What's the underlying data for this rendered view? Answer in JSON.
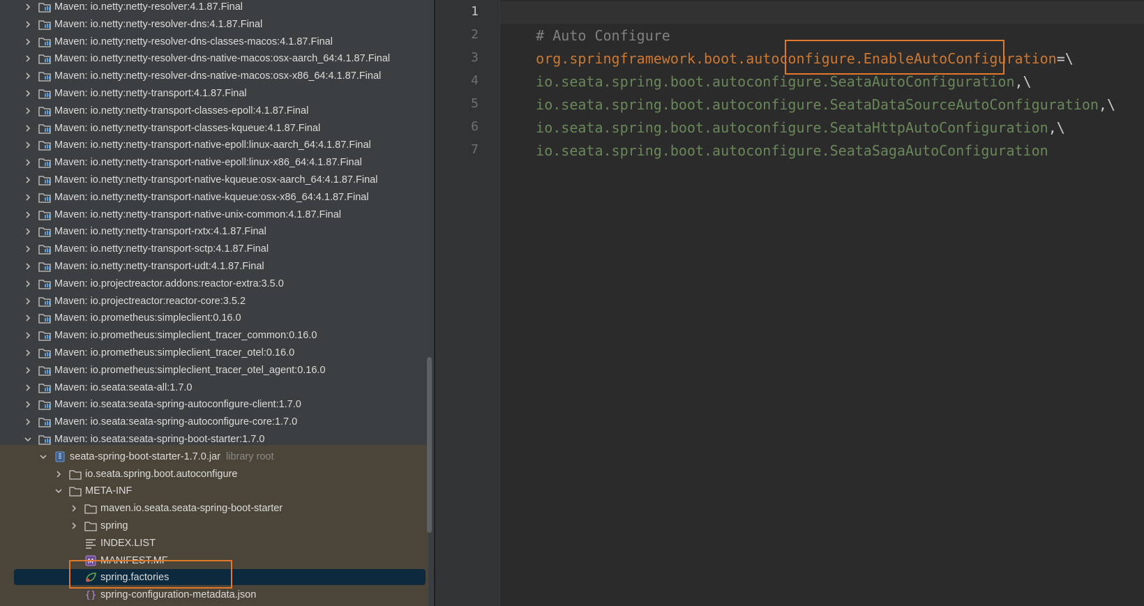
{
  "tree": {
    "rows": [
      {
        "label": "Maven: io.netty:netty-resolver:4.1.87.Final"
      },
      {
        "label": "Maven: io.netty:netty-resolver-dns:4.1.87.Final"
      },
      {
        "label": "Maven: io.netty:netty-resolver-dns-classes-macos:4.1.87.Final"
      },
      {
        "label": "Maven: io.netty:netty-resolver-dns-native-macos:osx-aarch_64:4.1.87.Final"
      },
      {
        "label": "Maven: io.netty:netty-resolver-dns-native-macos:osx-x86_64:4.1.87.Final"
      },
      {
        "label": "Maven: io.netty:netty-transport:4.1.87.Final"
      },
      {
        "label": "Maven: io.netty:netty-transport-classes-epoll:4.1.87.Final"
      },
      {
        "label": "Maven: io.netty:netty-transport-classes-kqueue:4.1.87.Final"
      },
      {
        "label": "Maven: io.netty:netty-transport-native-epoll:linux-aarch_64:4.1.87.Final"
      },
      {
        "label": "Maven: io.netty:netty-transport-native-epoll:linux-x86_64:4.1.87.Final"
      },
      {
        "label": "Maven: io.netty:netty-transport-native-kqueue:osx-aarch_64:4.1.87.Final"
      },
      {
        "label": "Maven: io.netty:netty-transport-native-kqueue:osx-x86_64:4.1.87.Final"
      },
      {
        "label": "Maven: io.netty:netty-transport-native-unix-common:4.1.87.Final"
      },
      {
        "label": "Maven: io.netty:netty-transport-rxtx:4.1.87.Final"
      },
      {
        "label": "Maven: io.netty:netty-transport-sctp:4.1.87.Final"
      },
      {
        "label": "Maven: io.netty:netty-transport-udt:4.1.87.Final"
      },
      {
        "label": "Maven: io.projectreactor.addons:reactor-extra:3.5.0"
      },
      {
        "label": "Maven: io.projectreactor:reactor-core:3.5.2"
      },
      {
        "label": "Maven: io.prometheus:simpleclient:0.16.0"
      },
      {
        "label": "Maven: io.prometheus:simpleclient_tracer_common:0.16.0"
      },
      {
        "label": "Maven: io.prometheus:simpleclient_tracer_otel:0.16.0"
      },
      {
        "label": "Maven: io.prometheus:simpleclient_tracer_otel_agent:0.16.0"
      },
      {
        "label": "Maven: io.seata:seata-all:1.7.0"
      },
      {
        "label": "Maven: io.seata:seata-spring-autoconfigure-client:1.7.0"
      },
      {
        "label": "Maven: io.seata:seata-spring-autoconfigure-core:1.7.0"
      },
      {
        "label": "Maven: io.seata:seata-spring-boot-starter:1.7.0"
      },
      {
        "label": "seata-spring-boot-starter-1.7.0.jar",
        "hint": "library root"
      },
      {
        "label": "io.seata.spring.boot.autoconfigure"
      },
      {
        "label": "META-INF"
      },
      {
        "label": "maven.io.seata.seata-spring-boot-starter"
      },
      {
        "label": "spring"
      },
      {
        "label": "INDEX.LIST"
      },
      {
        "label": "MANIFEST.MF"
      },
      {
        "label": "spring.factories"
      },
      {
        "label": "spring-configuration-metadata.json"
      }
    ]
  },
  "editor": {
    "line_numbers": [
      "1",
      "2",
      "3",
      "4",
      "5",
      "6",
      "7"
    ],
    "lines": [
      {
        "comment": "# Auto Configure"
      },
      {
        "key": "org.springframework.boot.autoconfigure.EnableAutoConfiguration",
        "sep": "=\\"
      },
      {
        "val": "io.seata.spring.boot.autoconfigure.SeataAutoConfiguration",
        "sep": ",\\"
      },
      {
        "val": "io.seata.spring.boot.autoconfigure.SeataDataSourceAutoConfiguration",
        "sep": ",\\"
      },
      {
        "val": "io.seata.spring.boot.autoconfigure.SeataHttpAutoConfiguration",
        "sep": ",\\"
      },
      {
        "val": "io.seata.spring.boot.autoconfigure.SeataSagaAutoConfiguration",
        "sep": ""
      },
      {}
    ]
  },
  "colors": {
    "comment": "#808080",
    "key": "#cc7832",
    "value": "#6a8759",
    "highlight_box": "#e07a2a",
    "selection": "#0d293e"
  },
  "icons": {
    "collapsed": "chevron-right-icon",
    "expanded": "chevron-down-icon",
    "library": "library-folder-icon",
    "jar": "jar-archive-icon",
    "folder": "folder-icon",
    "text_file": "text-file-icon",
    "manifest": "manifest-file-icon",
    "spring": "spring-leaf-icon",
    "json": "json-file-icon"
  }
}
